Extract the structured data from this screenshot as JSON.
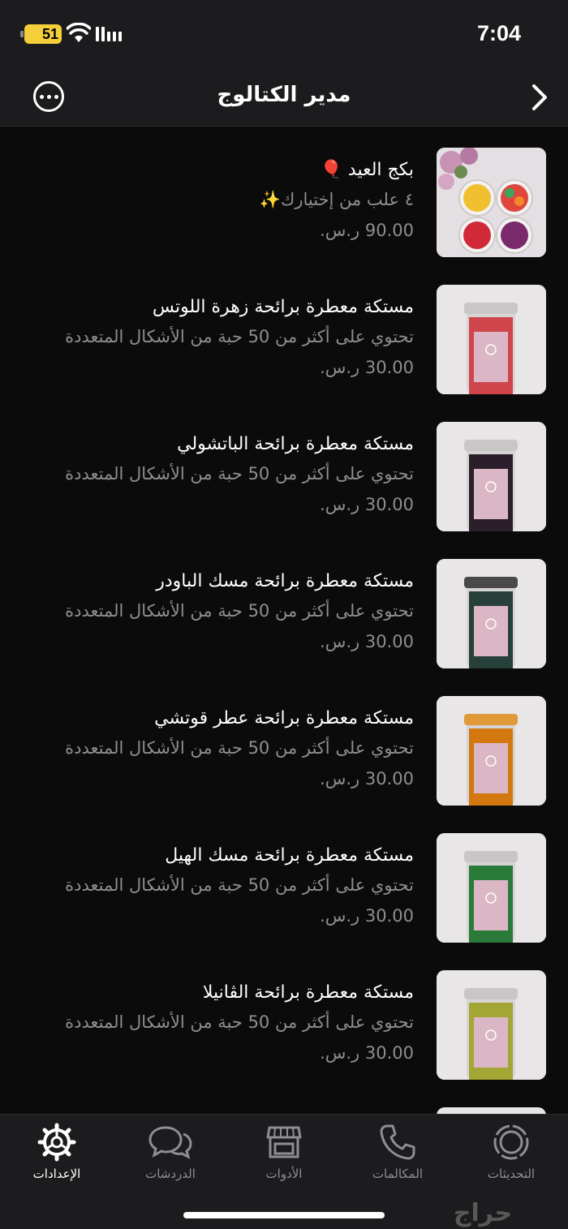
{
  "status_bar": {
    "time": "7:04",
    "battery_level": "51"
  },
  "nav": {
    "title": "مدير الكتالوج"
  },
  "items": [
    {
      "title": "بكج العيد 🎈",
      "description": "٤ علب من إختيارك✨",
      "price": "90.00 ر.س.",
      "image": "gift-box-photo"
    },
    {
      "title": "مستكة معطرة برائحة زهرة اللوتس",
      "description": "تحتوي على أكثر من 50 حبة من الأشكال المتعددة",
      "price": "30.00 ر.س.",
      "image": "jar-photo",
      "jar_color": "#d0444c"
    },
    {
      "title": "مستكة معطرة برائحة الباتشولي",
      "description": "تحتوي على أكثر من 50 حبة من الأشكال المتعددة",
      "price": "30.00 ر.س.",
      "image": "jar-photo",
      "jar_color": "#2a1f2a"
    },
    {
      "title": "مستكة معطرة برائحة مسك الباودر",
      "description": "تحتوي على أكثر من 50 حبة من الأشكال المتعددة",
      "price": "30.00 ر.س.",
      "image": "jar-photo",
      "jar_color": "#27403a"
    },
    {
      "title": "مستكة معطرة برائحة عطر قوتشي",
      "description": "تحتوي على أكثر من 50 حبة من الأشكال المتعددة",
      "price": "30.00 ر.س.",
      "image": "jar-photo",
      "jar_color": "#d2780e"
    },
    {
      "title": "مستكة معطرة برائحة مسك الهيل",
      "description": "تحتوي على أكثر من 50 حبة من الأشكال المتعددة",
      "price": "30.00 ر.س.",
      "image": "jar-photo",
      "jar_color": "#2a7a3a"
    },
    {
      "title": "مستكة معطرة برائحة الڤانيلا",
      "description": "تحتوي على أكثر من 50 حبة من الأشكال المتعددة",
      "price": "30.00 ر.س.",
      "image": "jar-photo",
      "jar_color": "#a3a534"
    }
  ],
  "tabs": [
    {
      "label": "الإعدادات",
      "icon": "settings-gear-icon",
      "active": true
    },
    {
      "label": "الدردشات",
      "icon": "chats-bubbles-icon",
      "active": false
    },
    {
      "label": "الأدوات",
      "icon": "tools-store-icon",
      "active": false
    },
    {
      "label": "المكالمات",
      "icon": "phone-icon",
      "active": false
    },
    {
      "label": "التحديثات",
      "icon": "updates-status-icon",
      "active": false
    }
  ],
  "watermark": "حراج",
  "colors": {
    "background": "#0b0b0b",
    "bar_background": "#1c1c1e",
    "secondary_text": "#8e8e93",
    "battery": "#f4cf3a"
  }
}
